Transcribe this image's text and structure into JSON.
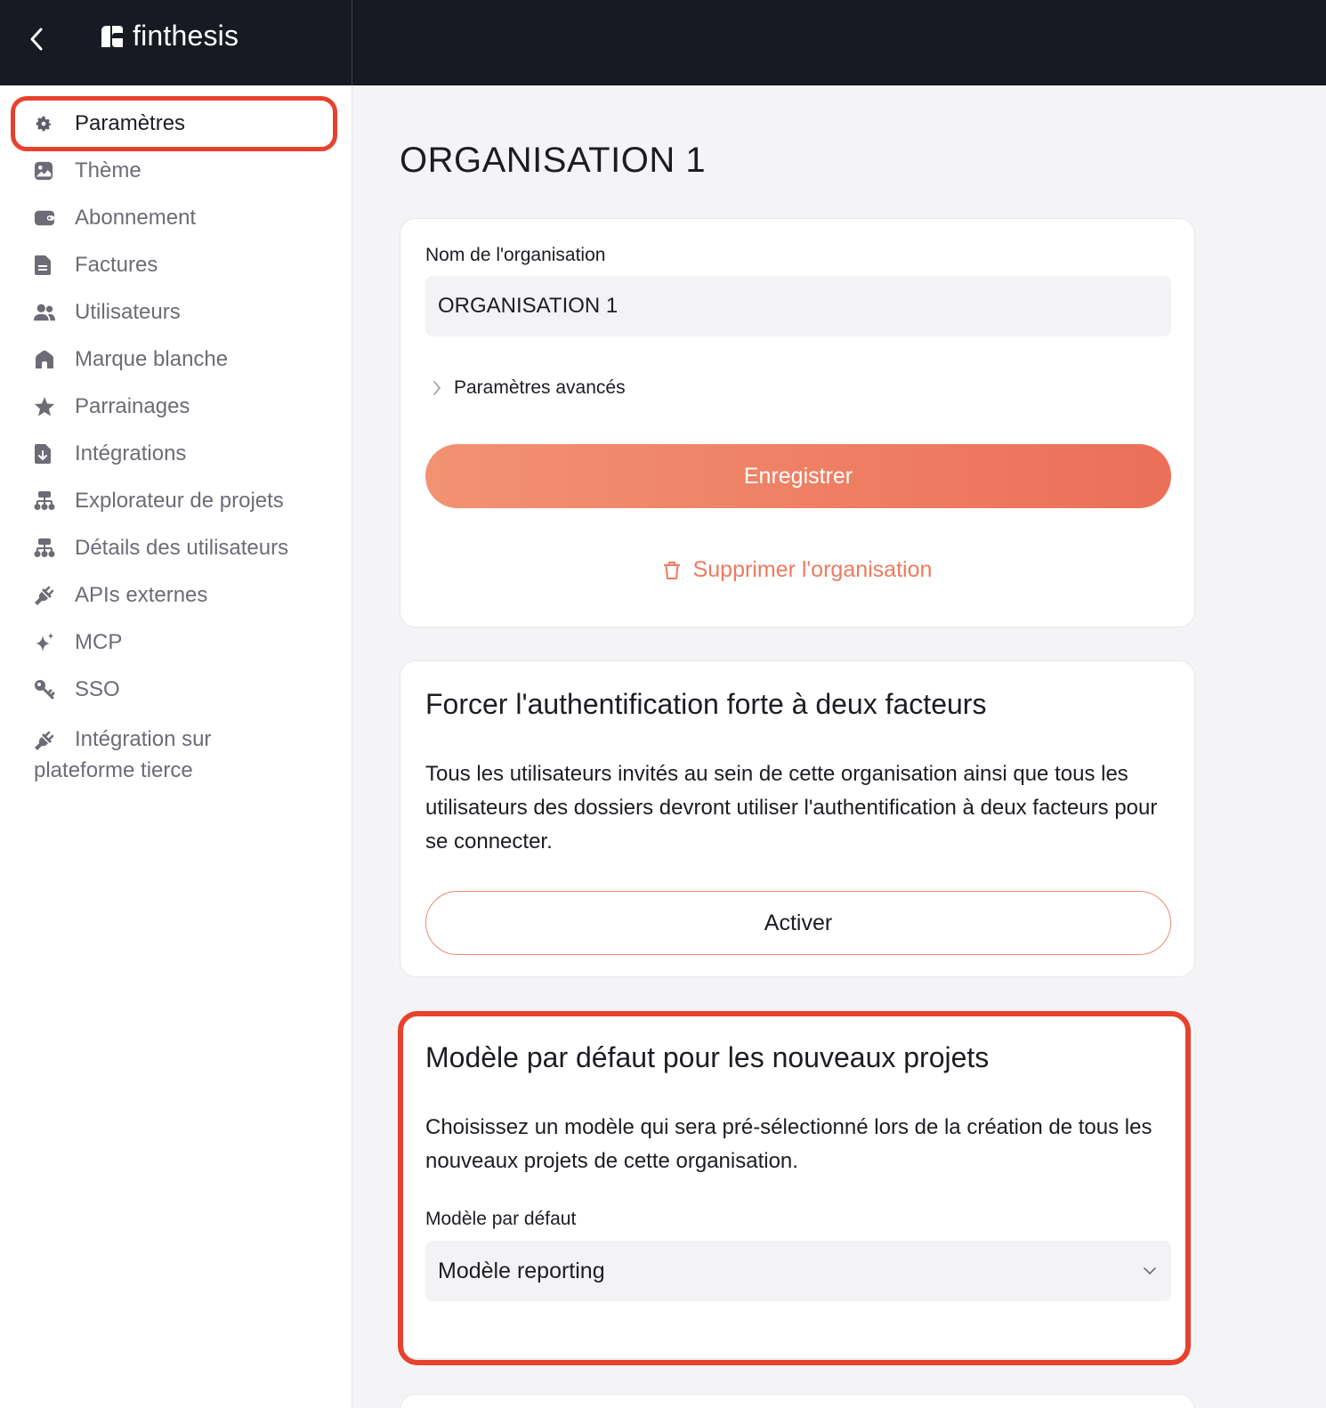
{
  "app": {
    "brand": "finthesis"
  },
  "sidebar": {
    "items": [
      {
        "label": "Paramètres",
        "icon": "gear-icon",
        "active": true
      },
      {
        "label": "Thème",
        "icon": "image-icon"
      },
      {
        "label": "Abonnement",
        "icon": "wallet-icon"
      },
      {
        "label": "Factures",
        "icon": "document-icon"
      },
      {
        "label": "Utilisateurs",
        "icon": "users-icon"
      },
      {
        "label": "Marque blanche",
        "icon": "home-icon"
      },
      {
        "label": "Parrainages",
        "icon": "star-icon"
      },
      {
        "label": "Intégrations",
        "icon": "download-doc-icon"
      },
      {
        "label": "Explorateur de projets",
        "icon": "hierarchy-icon"
      },
      {
        "label": "Détails des utilisateurs",
        "icon": "hierarchy-icon"
      },
      {
        "label": "APIs externes",
        "icon": "plug-icon"
      },
      {
        "label": "MCP",
        "icon": "sparkle-icon"
      },
      {
        "label": "SSO",
        "icon": "key-icon"
      },
      {
        "label_line1": "Intégration sur",
        "label_line2": "plateforme tierce",
        "icon": "plug-icon"
      }
    ]
  },
  "main": {
    "title": "ORGANISATION 1",
    "org_card": {
      "name_label": "Nom de l'organisation",
      "name_value": "ORGANISATION 1",
      "advanced_label": "Paramètres avancés",
      "save_label": "Enregistrer",
      "delete_label": "Supprimer l'organisation"
    },
    "twofa_card": {
      "title": "Forcer l'authentification forte à deux facteurs",
      "description": "Tous les utilisateurs invités au sein de cette organisation ainsi que tous les utilisateurs des dossiers devront utiliser l'authentification à deux facteurs pour se connecter.",
      "activate_label": "Activer"
    },
    "template_card": {
      "title": "Modèle par défaut pour les nouveaux projets",
      "description": "Choisissez un modèle qui sera pré-sélectionné lors de la création de tous les nouveaux projets de cette organisation.",
      "select_label": "Modèle par défaut",
      "select_value": "Modèle reporting"
    }
  },
  "colors": {
    "topbar": "#181a23",
    "accent": "#ec6f57",
    "highlight": "#e8412e",
    "sidebar_text": "#6b6c76"
  }
}
